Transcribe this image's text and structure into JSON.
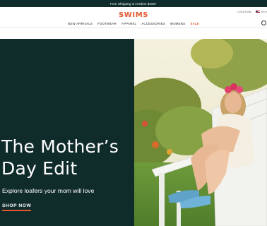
{
  "promo": {
    "text": "Free Shipping on Orders $150+"
  },
  "utility": {
    "location_label": "LOCATION:",
    "currency": "US",
    "lang": "▾"
  },
  "brand": {
    "logo": "SWIMS"
  },
  "nav": {
    "items": [
      "NEW ARRIVALS",
      "FOOTWEAR",
      "APPAREL",
      "ACCESSORIES",
      "WOMENS",
      "SALE"
    ]
  },
  "hero": {
    "title_line1": "The Mother’s",
    "title_line2": "Day Edit",
    "subtitle": "Explore loafers your mom will love",
    "cta": "SHOP NOW"
  },
  "icons": {
    "search": "search-icon",
    "flag": "us-flag-icon"
  },
  "colors": {
    "dark_teal": "#0f2b2a",
    "accent_orange": "#e4572e",
    "sale_red": "#e4572e"
  }
}
